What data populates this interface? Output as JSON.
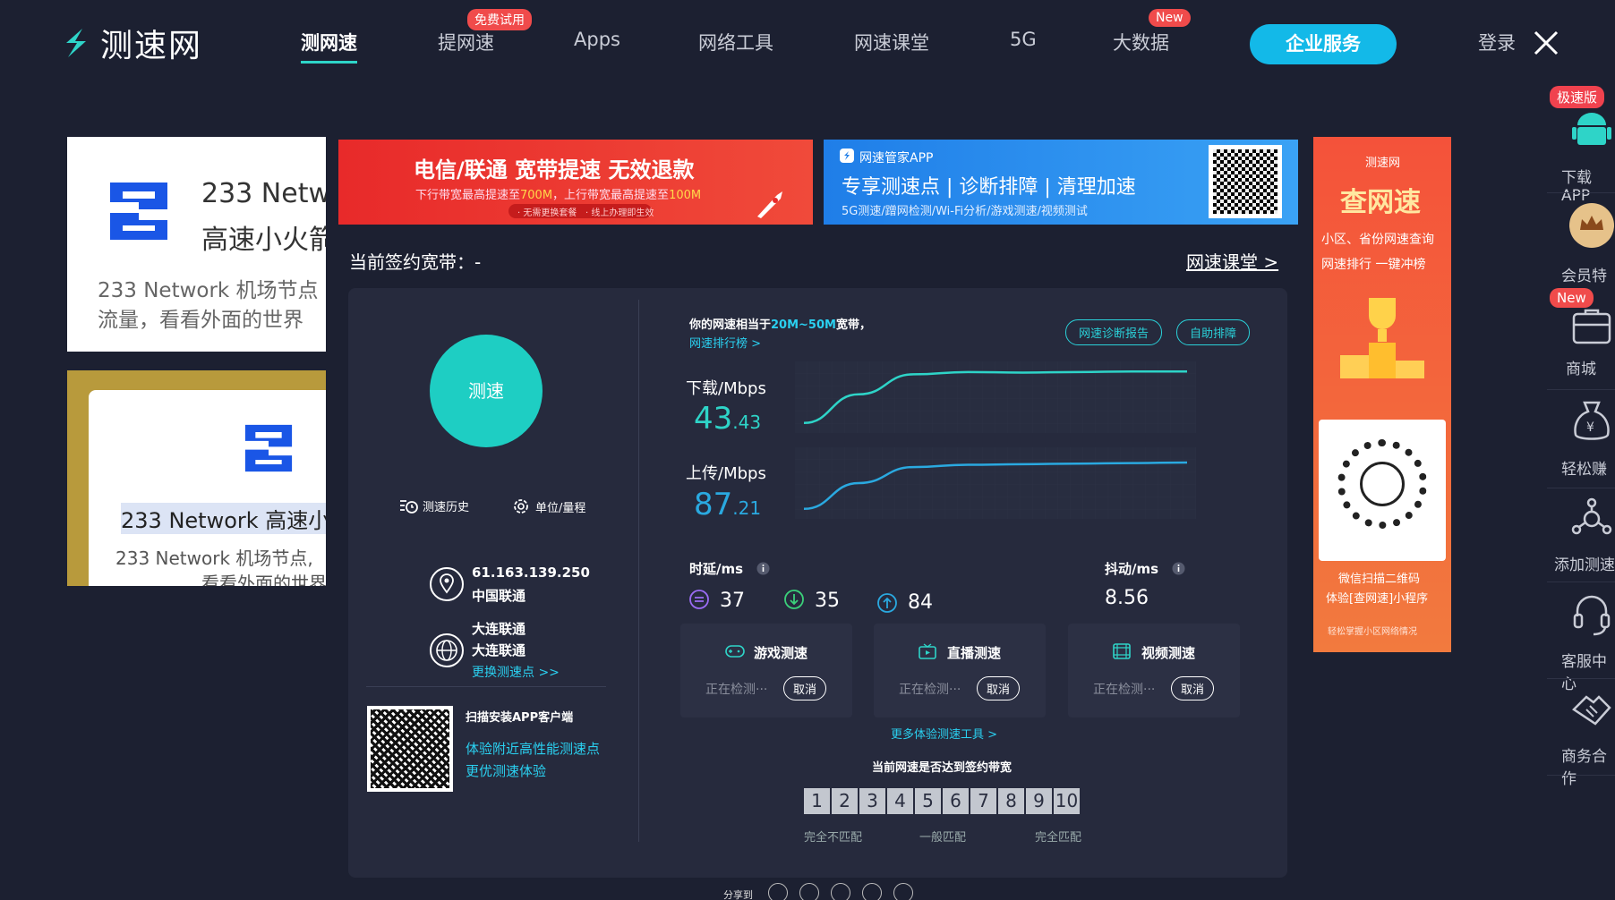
{
  "header": {
    "logo_text": "测速网",
    "nav": [
      {
        "label": "测网速",
        "active": true
      },
      {
        "label": "提网速",
        "badge": "免费试用"
      },
      {
        "label": "Apps"
      },
      {
        "label": "网络工具"
      },
      {
        "label": "网速课堂"
      },
      {
        "label": "5G"
      },
      {
        "label": "大数据",
        "badge": "New"
      }
    ],
    "enterprise_button": "企业服务",
    "login": "登录"
  },
  "left_ads": {
    "ad1": {
      "title_l1": "233 Netw",
      "title_l2": "高速小火箭",
      "desc_l1": "233 Network 机场节点",
      "desc_l2": "流量，看看外面的世界"
    },
    "ad2": {
      "title": "233 Network 高速小",
      "desc_l1": "233 Network 机场节点,",
      "desc_l2": "看看外面的世界"
    }
  },
  "banners": {
    "red": {
      "title": "电信/联通 宽带提速 无效退款",
      "sub_pre": "下行带宽最高提速至",
      "sub_v1": "700M",
      "sub_mid": "，上行带宽最高提速至",
      "sub_v2": "100M",
      "small1": "· 无需更换套餐",
      "small2": "· 线上办理即生效"
    },
    "blue": {
      "app": "网速管家APP",
      "main": "专享测速点 | 诊断排障 | 清理加速",
      "sub": "5G测速/蹭网检测/Wi-Fi分析/游戏测速/视频测试"
    }
  },
  "signed_bandwidth": "当前签约宽带：-",
  "classroom_link": "网速课堂 >",
  "test": {
    "button": "测速",
    "history": "测速历史",
    "unit": "单位/量程",
    "ip": "61.163.139.250",
    "isp": "中国联通",
    "node_l1": "大连联通",
    "node_l2": "大连联通",
    "change_node": "更换测速点 >>",
    "qr_title": "扫描安装APP客户端",
    "qr_l1": "体验附近高性能测速点",
    "qr_l2": "更优测速体验"
  },
  "result": {
    "equiv_pre": "你的网速相当于",
    "equiv_range": "20M~50M",
    "equiv_post": "宽带，",
    "rank_link": "网速排行榜 >",
    "diag_btn": "网速诊断报告",
    "fix_btn": "自助排障",
    "download_label": "下载/Mbps",
    "download_int": "43",
    "download_dec": ".43",
    "upload_label": "上传/Mbps",
    "upload_int": "87",
    "upload_dec": ".21",
    "latency_label": "时延/ms",
    "latency_vals": [
      "37",
      "35",
      "84"
    ],
    "jitter_label": "抖动/ms",
    "jitter_val": "8.56",
    "download_curve": [
      0.05,
      0.55,
      0.9,
      0.94,
      0.93,
      0.94,
      0.95,
      0.95
    ],
    "upload_curve": [
      0.05,
      0.5,
      0.78,
      0.82,
      0.83,
      0.84,
      0.85,
      0.86
    ]
  },
  "cards": [
    {
      "title": "游戏测速",
      "status": "正在检测···",
      "cancel": "取消"
    },
    {
      "title": "直播测速",
      "status": "正在检测···",
      "cancel": "取消"
    },
    {
      "title": "视频测速",
      "status": "正在检测···",
      "cancel": "取消"
    }
  ],
  "more_tools": "更多体验测速工具 >",
  "match_title": "当前网速是否达到签约带宽",
  "match_scale": [
    "1",
    "2",
    "3",
    "4",
    "5",
    "6",
    "7",
    "8",
    "9",
    "10"
  ],
  "match_labels": [
    "完全不匹配",
    "一般匹配",
    "完全匹配"
  ],
  "share_label": "分享到",
  "right_ad": {
    "brand": "测速网",
    "title": "查网速",
    "sub1": "小区、省份网速查询",
    "sub2": "网速排行 一键冲榜",
    "scan1": "微信扫描二维码",
    "scan2": "体验[查网速]小程序",
    "scan3": "轻松掌握小区网络情况"
  },
  "sidebar": [
    {
      "label": "下载APP",
      "badge": "极速版"
    },
    {
      "label": "会员特权"
    },
    {
      "label": "商城",
      "badge": "New"
    },
    {
      "label": "轻松赚"
    },
    {
      "label": "添加测速"
    },
    {
      "label": "客服中心"
    },
    {
      "label": "商务合作"
    }
  ],
  "colors": {
    "bg": "#1c2031",
    "panel": "#262a3d",
    "accent": "#2ed4c8",
    "enterprise": "#13b9e8",
    "badge": "#f04b4b"
  }
}
